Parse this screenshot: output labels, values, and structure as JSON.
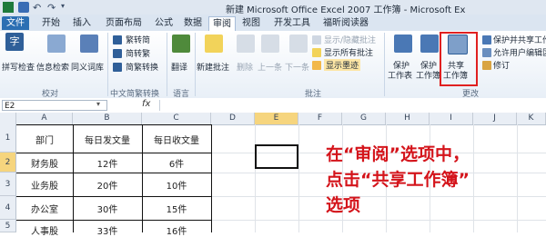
{
  "titlebar": {
    "title": "新建 Microsoft Office Excel 2007 工作簿 - Microsoft Ex"
  },
  "tabs": [
    "文件",
    "开始",
    "插入",
    "页面布局",
    "公式",
    "数据",
    "审阅",
    "视图",
    "开发工具",
    "福昕阅读器"
  ],
  "ribbon": {
    "proofing": {
      "spell": "拼写检查",
      "research": "信息检索",
      "thesaurus": "同义词库",
      "group": "校对"
    },
    "chinese": {
      "t2s": "繁转简",
      "s2t": "简转繁",
      "convert": "简繁转换",
      "group": "中文简繁转换"
    },
    "language": {
      "translate": "翻译",
      "group": "语言"
    },
    "comments": {
      "new": "新建批注",
      "delete": "删除",
      "prev": "上一条",
      "next": "下一条",
      "showhide": "显示/隐藏批注",
      "showall": "显示所有批注",
      "ink": "显示墨迹",
      "group": "批注"
    },
    "changes": {
      "protect_sheet": [
        "保护",
        "工作表"
      ],
      "protect_wb": [
        "保护",
        "工作簿"
      ],
      "share_wb": [
        "共享",
        "工作簿"
      ],
      "protect_share": "保护并共享工作簿",
      "allow_edit": "允许用户编辑区域",
      "track": "修订",
      "group": "更改"
    }
  },
  "formula": {
    "name_box": "E2",
    "fx": "fx"
  },
  "columns": [
    "A",
    "B",
    "C",
    "D",
    "E",
    "F",
    "G",
    "H",
    "I",
    "J",
    "K"
  ],
  "rows": [
    "1",
    "2",
    "3",
    "4",
    "5"
  ],
  "table": {
    "header": [
      "部门",
      "每日发文量",
      "每日收文量"
    ],
    "rows": [
      [
        "财务股",
        "12件",
        "6件"
      ],
      [
        "业务股",
        "20件",
        "10件"
      ],
      [
        "办公室",
        "30件",
        "15件"
      ],
      [
        "人事股",
        "33件",
        "16件"
      ]
    ]
  },
  "annotation": [
    "在“审阅”选项中，",
    "点击“共享工作簿”",
    "选项"
  ],
  "colors": {
    "accent": "#2c6fb3",
    "annotation": "#d4141b"
  }
}
